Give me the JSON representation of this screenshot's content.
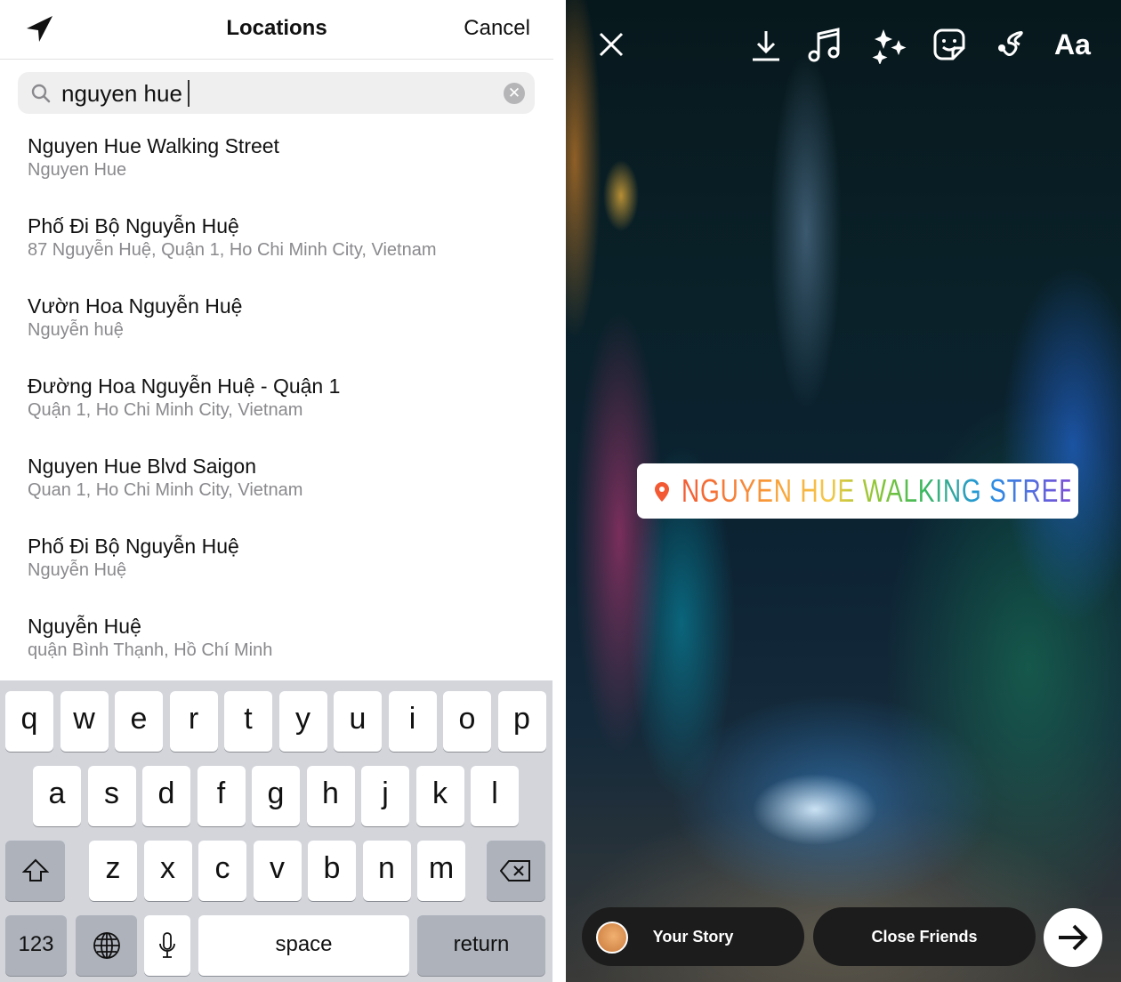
{
  "header": {
    "title": "Locations",
    "cancel_label": "Cancel",
    "location_icon": "location-arrow-icon"
  },
  "search": {
    "value": "nguyen hue",
    "search_icon": "magnifier-icon",
    "clear_icon": "clear-circle-icon"
  },
  "results": [
    {
      "title": "Nguyen Hue Walking Street",
      "subtitle": "Nguyen Hue"
    },
    {
      "title": "Phố Đi Bộ Nguyễn Huệ",
      "subtitle": "87 Nguyễn Huệ, Quận 1, Ho Chi Minh City, Vietnam"
    },
    {
      "title": "Vườn Hoa Nguyễn Huệ",
      "subtitle": "Nguyễn huệ"
    },
    {
      "title": "Đường Hoa Nguyễn Huệ - Quận 1",
      "subtitle": "Quận 1, Ho Chi Minh City, Vietnam"
    },
    {
      "title": "Nguyen Hue Blvd Saigon",
      "subtitle": "Quan 1, Ho Chi Minh City, Vietnam"
    },
    {
      "title": "Phố Đi Bộ Nguyễn Huệ",
      "subtitle": "Nguyễn Huệ"
    },
    {
      "title": "Nguyễn Huệ",
      "subtitle": "quận Bình Thạnh, Hồ Chí Minh"
    }
  ],
  "keyboard": {
    "row1": [
      "q",
      "w",
      "e",
      "r",
      "t",
      "y",
      "u",
      "i",
      "o",
      "p"
    ],
    "row2": [
      "a",
      "s",
      "d",
      "f",
      "g",
      "h",
      "j",
      "k",
      "l"
    ],
    "row3": [
      "z",
      "x",
      "c",
      "v",
      "b",
      "n",
      "m"
    ],
    "numbers_label": "123",
    "space_label": "space",
    "return_label": "return"
  },
  "story": {
    "text_tool_label": "Aa",
    "sticker_text": "NGUYEN HUE WALKING STREET",
    "sticker_pin_color": "#f35a33",
    "your_story_label": "Your Story",
    "close_friends_label": "Close Friends"
  }
}
